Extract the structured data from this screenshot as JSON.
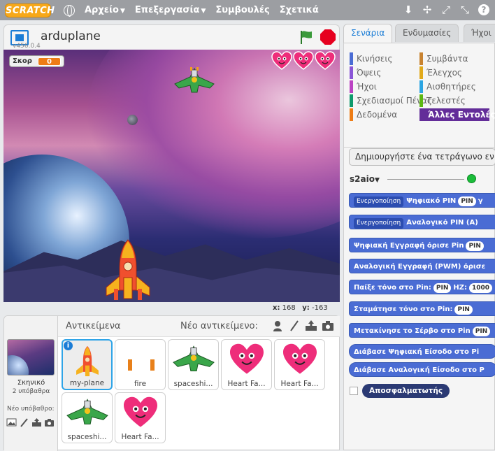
{
  "menubar": {
    "logo_text": "SCRATCH",
    "items": [
      "Αρχείο",
      "Επεξεργασία",
      "Συμβουλές",
      "Σχετικά"
    ]
  },
  "stage": {
    "project_title": "arduplane",
    "version": "v456.0.4",
    "monitor_label": "Σκορ",
    "monitor_value": "0",
    "coord_x_label": "x:",
    "coord_x": "168",
    "coord_y_label": "y:",
    "coord_y": "-163"
  },
  "sprites": {
    "title": "Αντικείμενα",
    "new_sprite_label": "Νέο αντικείμενο:",
    "stage_label": "Σκηνικό",
    "stage_sub": "2 υπόβαθρα",
    "new_backdrop_label": "Νέο υπόβαθρο:",
    "items": [
      {
        "name": "my-plane",
        "kind": "rocket",
        "selected": true
      },
      {
        "name": "fire",
        "kind": "fire"
      },
      {
        "name": "spaceshi...",
        "kind": "ship"
      },
      {
        "name": "Heart Fa...",
        "kind": "heart"
      },
      {
        "name": "Heart Fa...",
        "kind": "heart"
      },
      {
        "name": "spaceshi...",
        "kind": "ship"
      },
      {
        "name": "Heart Fa...",
        "kind": "heart"
      }
    ]
  },
  "palette": {
    "tabs": [
      "Σενάρια",
      "Ενδυμασίες",
      "Ήχοι"
    ],
    "categories": [
      {
        "label": "Κινήσεις",
        "color": "#4a6cd4"
      },
      {
        "label": "Όψεις",
        "color": "#8a55d7"
      },
      {
        "label": "Ήχοι",
        "color": "#bb42c3"
      },
      {
        "label": "Σχεδιασμοί Πένας",
        "color": "#0e9a6c"
      },
      {
        "label": "Δεδομένα",
        "color": "#ee7d16"
      },
      {
        "label": "Συμβάντα",
        "color": "#c88330"
      },
      {
        "label": "Έλεγχος",
        "color": "#e1a91a"
      },
      {
        "label": "Αισθητήρες",
        "color": "#2ca5e2"
      },
      {
        "label": "Τελεστές",
        "color": "#5cb712"
      },
      {
        "label": "Άλλες Εντολές",
        "color": "#632d99"
      }
    ],
    "make_block": "Δημιουργήστε ένα τετράγωνο εν",
    "extension_name": "s2aio",
    "blocks": [
      {
        "pre": "Ενεργοποίηση",
        "text": "Ψηφιακό PIN",
        "slot": "PIN",
        "post": "γ"
      },
      {
        "pre": "Ενεργοποίηση",
        "text": "Αναλογικό PIN (A)",
        "slot": "",
        "post": ""
      },
      {
        "pre": "",
        "text": "Ψηφιακή Εγγραφή όρισε Pin",
        "slot": "PIN",
        "post": ""
      },
      {
        "pre": "",
        "text": "Αναλογική Εγγραφή (PWM) όρισε",
        "slot": "",
        "post": ""
      },
      {
        "pre": "",
        "text": "Παίξε τόνο στο Pin:",
        "slot": "PIN",
        "post": "HZ:",
        "slot2": "1000"
      },
      {
        "pre": "",
        "text": "Σταμάτησε τόνο στο Pin:",
        "slot": "PIN",
        "post": ""
      },
      {
        "pre": "",
        "text": "Μετακίνησε το Σέρβο στο Pin",
        "slot": "PIN",
        "post": ""
      },
      {
        "pre": "",
        "text": "Διάβασε Ψηφιακή Είσοδο στο Pi",
        "slot": "",
        "post": ""
      },
      {
        "pre": "",
        "text": "Διάβασε Αναλογική Είσοδο στο P",
        "slot": "",
        "post": ""
      }
    ],
    "debug_label": "Αποσφαλματωτής"
  }
}
